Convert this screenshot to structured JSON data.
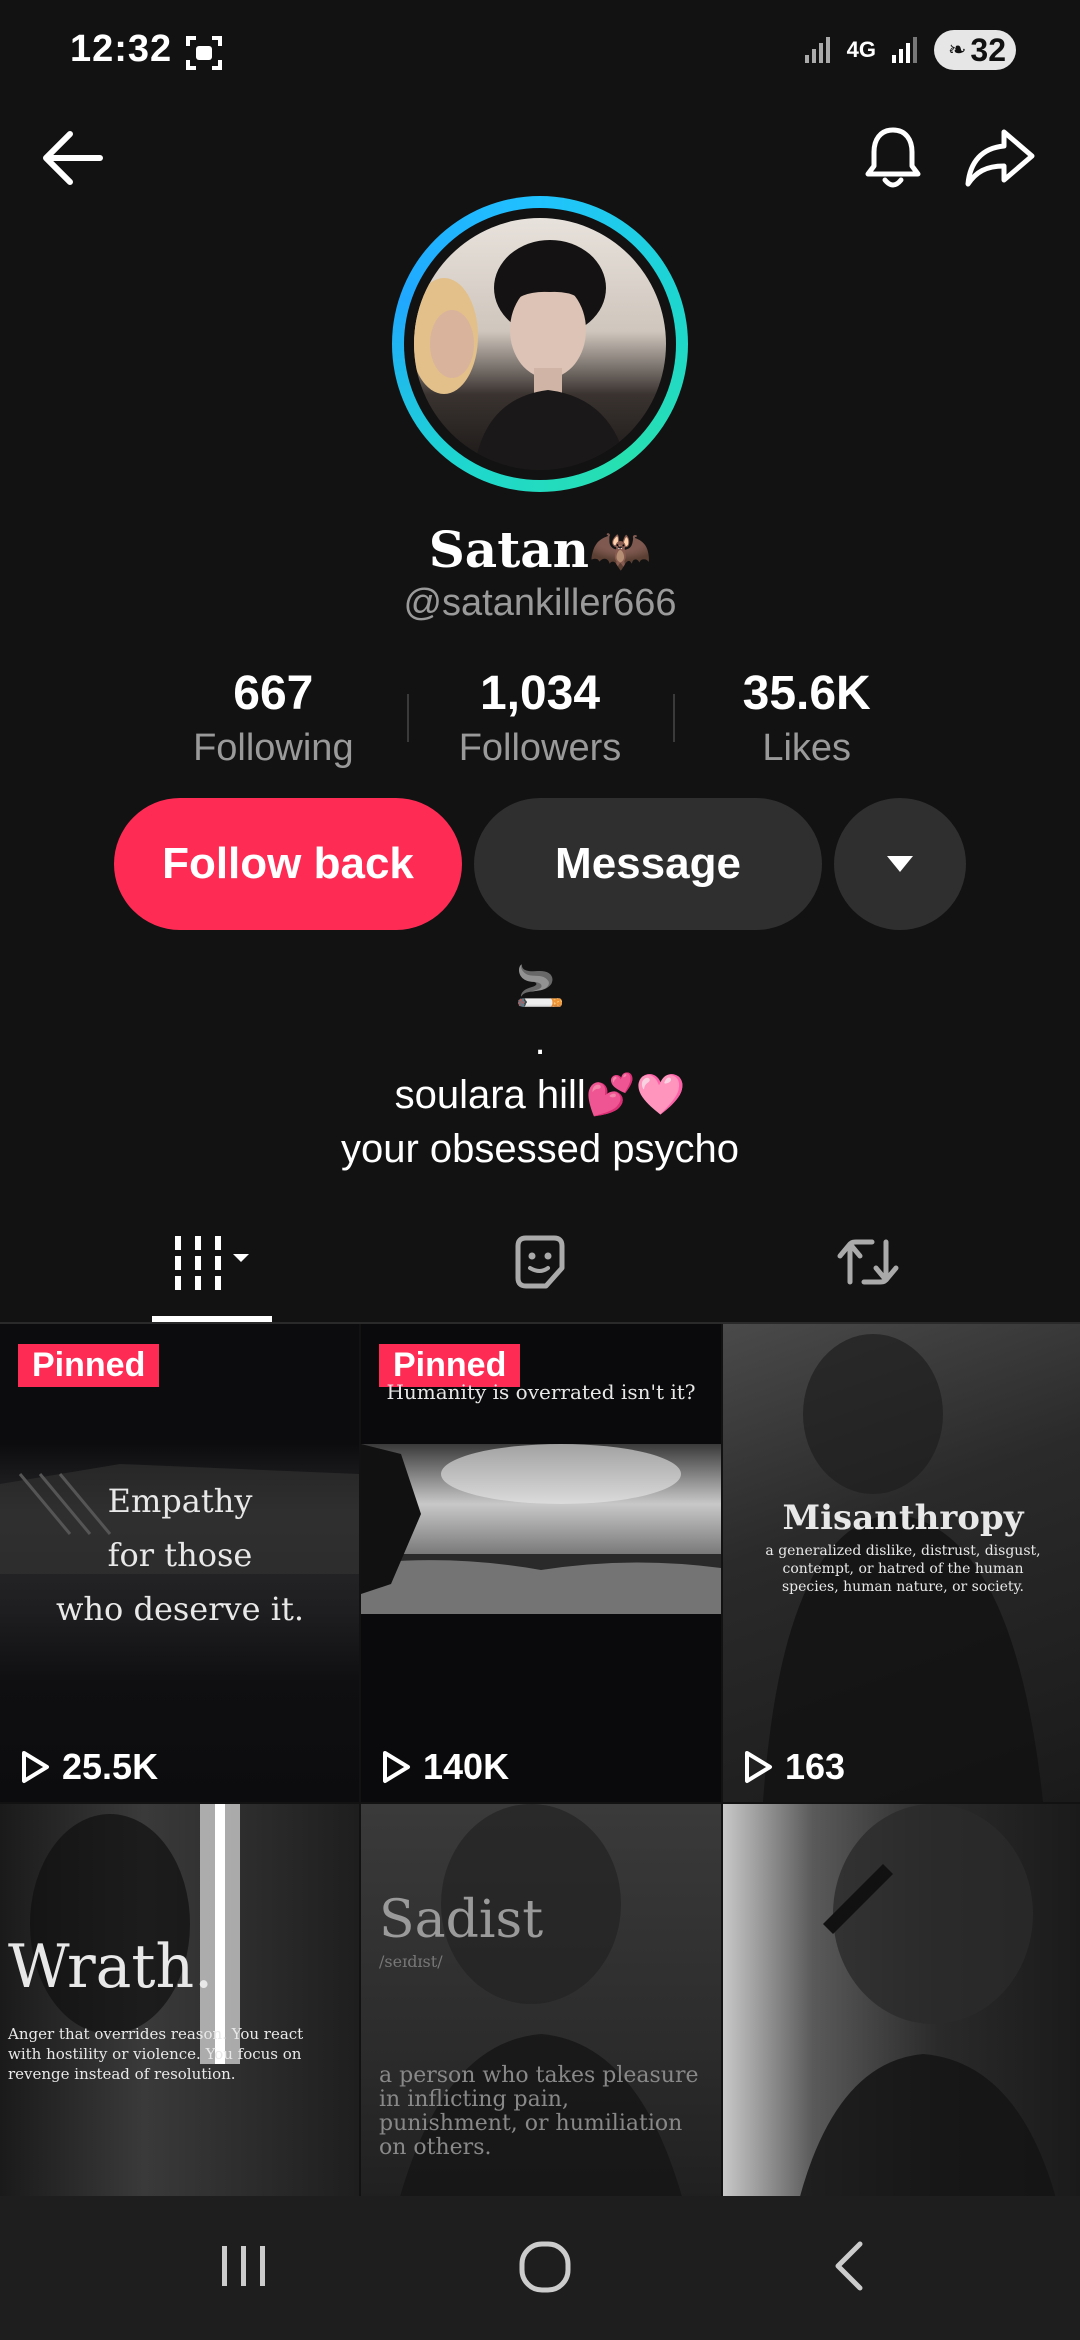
{
  "status_bar": {
    "time": "12:32",
    "network": "4G",
    "battery": "32"
  },
  "profile": {
    "display_name": "Satan🦇",
    "username": "@satankiller666",
    "stats": [
      {
        "value": "667",
        "label": "Following"
      },
      {
        "value": "1,034",
        "label": "Followers"
      },
      {
        "value": "35.6K",
        "label": "Likes"
      }
    ],
    "buttons": {
      "follow": "Follow back",
      "message": "Message"
    },
    "bio": [
      "🚬",
      ".",
      "soulara hill💕🩷",
      "your obsessed psycho"
    ]
  },
  "tabs": [
    {
      "name": "videos",
      "icon": "grid-icon",
      "active": true
    },
    {
      "name": "favorites",
      "icon": "sticker-icon",
      "active": false
    },
    {
      "name": "reposts",
      "icon": "repost-icon",
      "active": false
    }
  ],
  "videos": [
    {
      "pinned": "Pinned",
      "views": "25.5K",
      "lines": [
        "Empathy",
        "for those",
        "who deserve it."
      ]
    },
    {
      "pinned": "Pinned",
      "views": "140K",
      "caption": "Humanity is overrated isn't it?"
    },
    {
      "views": "163",
      "title": "Misanthropy",
      "subtitle": "a generalized dislike, distrust, disgust, contempt, or hatred  of the human species, human nature, or society."
    },
    {
      "title": "Wrath.",
      "subtitle": "Anger that overrides reason. You react with hostility or violence. You focus on revenge instead of resolution."
    },
    {
      "title": "Sadist",
      "phonetic": "/seɪdɪst/",
      "subtitle": "a person who takes pleasure in inflicting pain, punishment, or humiliation on others."
    },
    {}
  ],
  "colors": {
    "accent": "#fe2c55",
    "background": "#121212",
    "secondary_button": "#2f2f2f",
    "muted_text": "#9a9a9a"
  }
}
